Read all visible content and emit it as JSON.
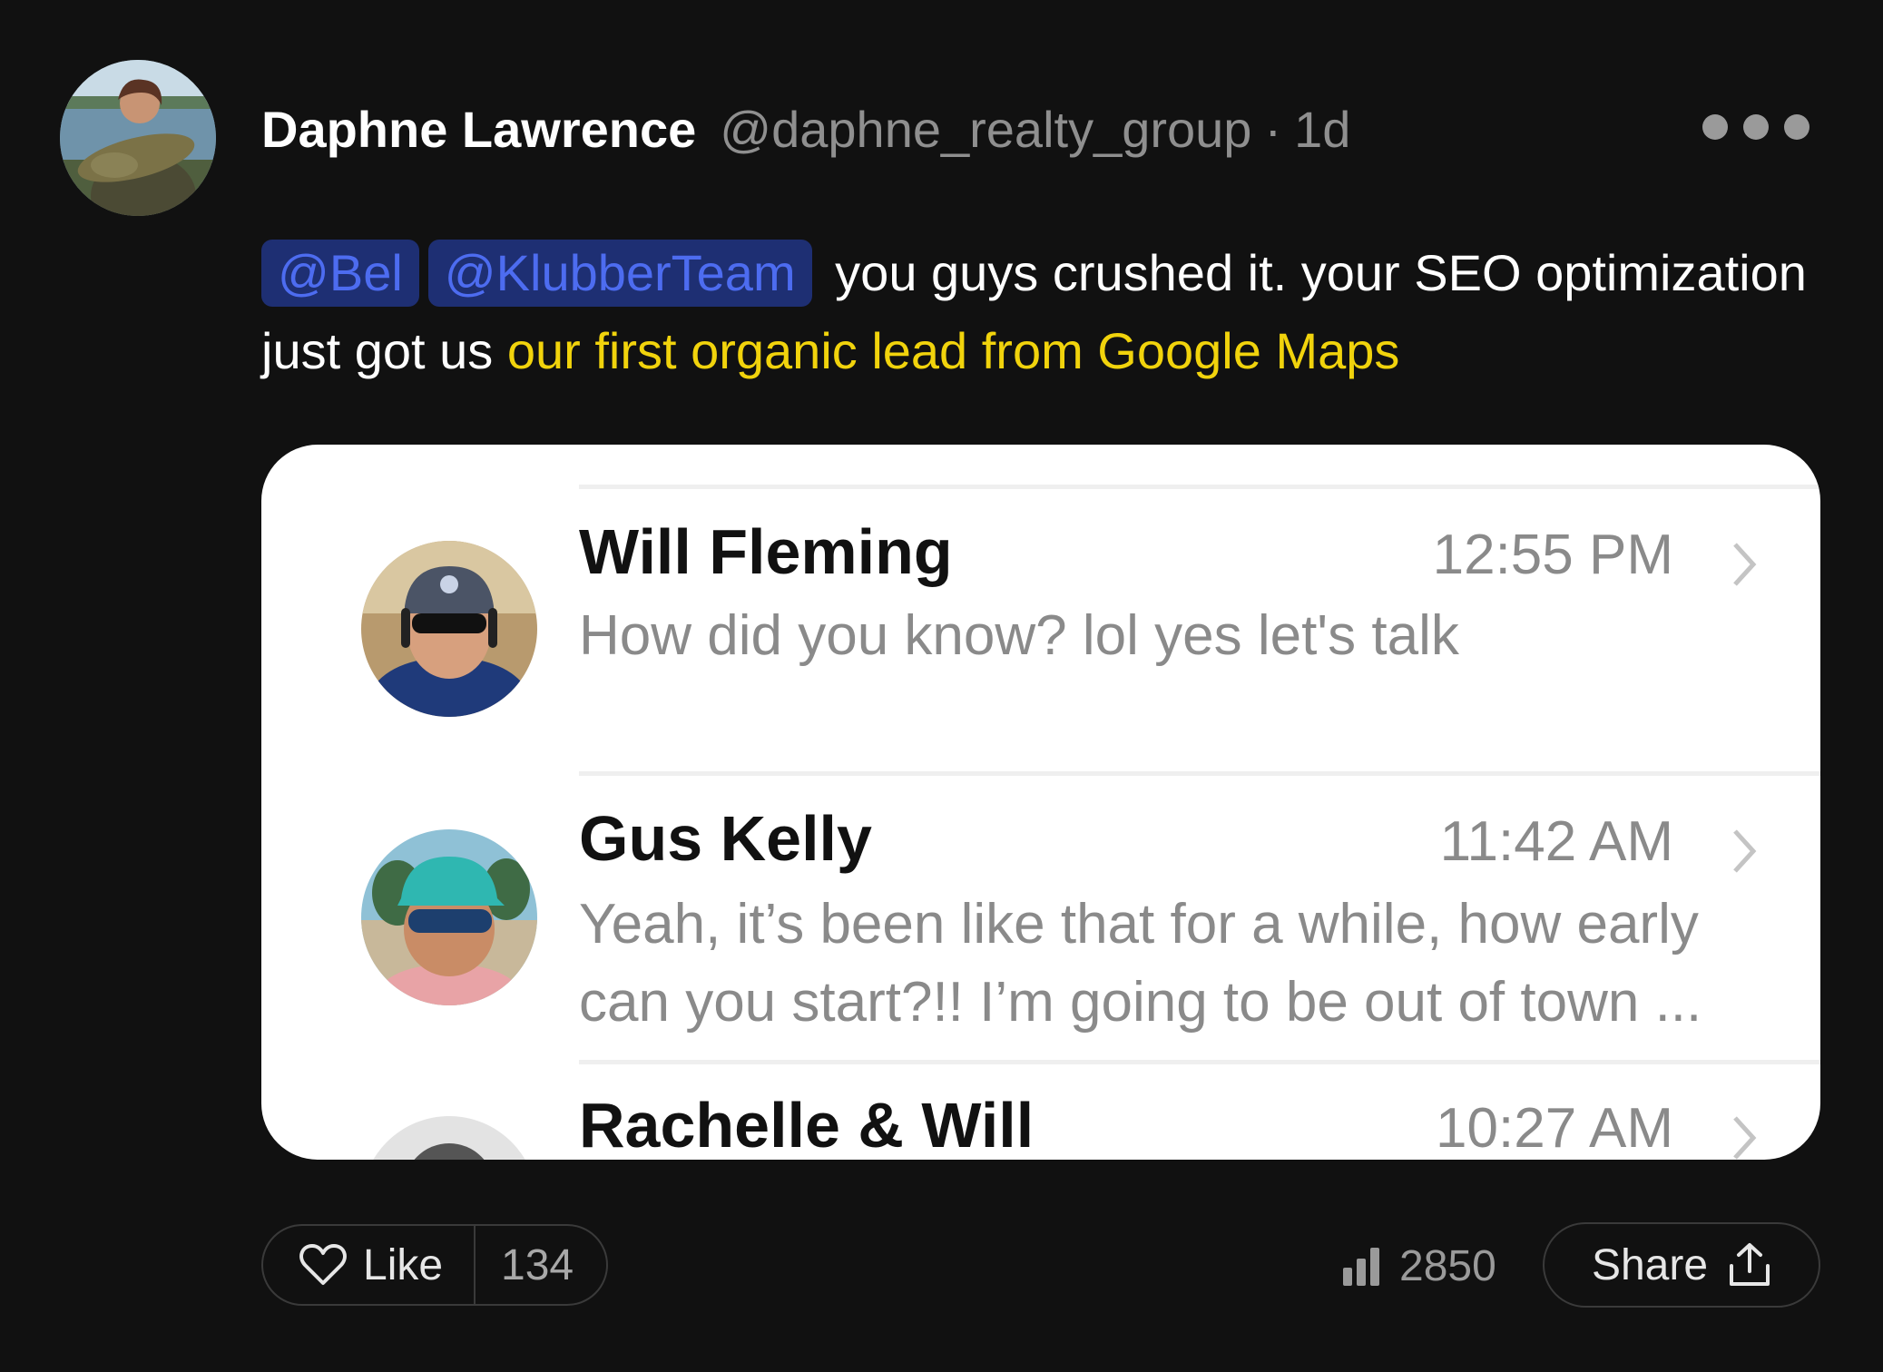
{
  "post": {
    "author_name": "Daphne Lawrence",
    "author_handle": "@daphne_realty_group",
    "separator": "·",
    "age": "1d",
    "mentions": [
      "@Bel",
      "@KlubberTeam"
    ],
    "text_part1": "you guys crushed it. your SEO optimization just got us",
    "text_highlight": "our first organic lead from Google Maps",
    "highlight_color": "#f1d30c",
    "mention_color": "#4d6cf0"
  },
  "screenshot": {
    "messages": [
      {
        "name": "Will Fleming",
        "time": "12:55 PM",
        "preview": "How did you know? lol yes let's talk"
      },
      {
        "name": "Gus Kelly",
        "time": "11:42 AM",
        "preview": "Yeah, it’s been like that for a while, how early can you start?!! I’m going to be out of town ..."
      },
      {
        "name": "Rachelle & Will",
        "time": "10:27 AM",
        "preview": ""
      }
    ]
  },
  "actions": {
    "like_label": "Like",
    "like_count": "134",
    "views_count": "2850",
    "share_label": "Share"
  },
  "icons": {
    "more": "more-options-icon",
    "like": "heart-icon",
    "views": "bar-chart-icon",
    "share": "share-upload-icon",
    "chevron": "chevron-right-icon"
  }
}
